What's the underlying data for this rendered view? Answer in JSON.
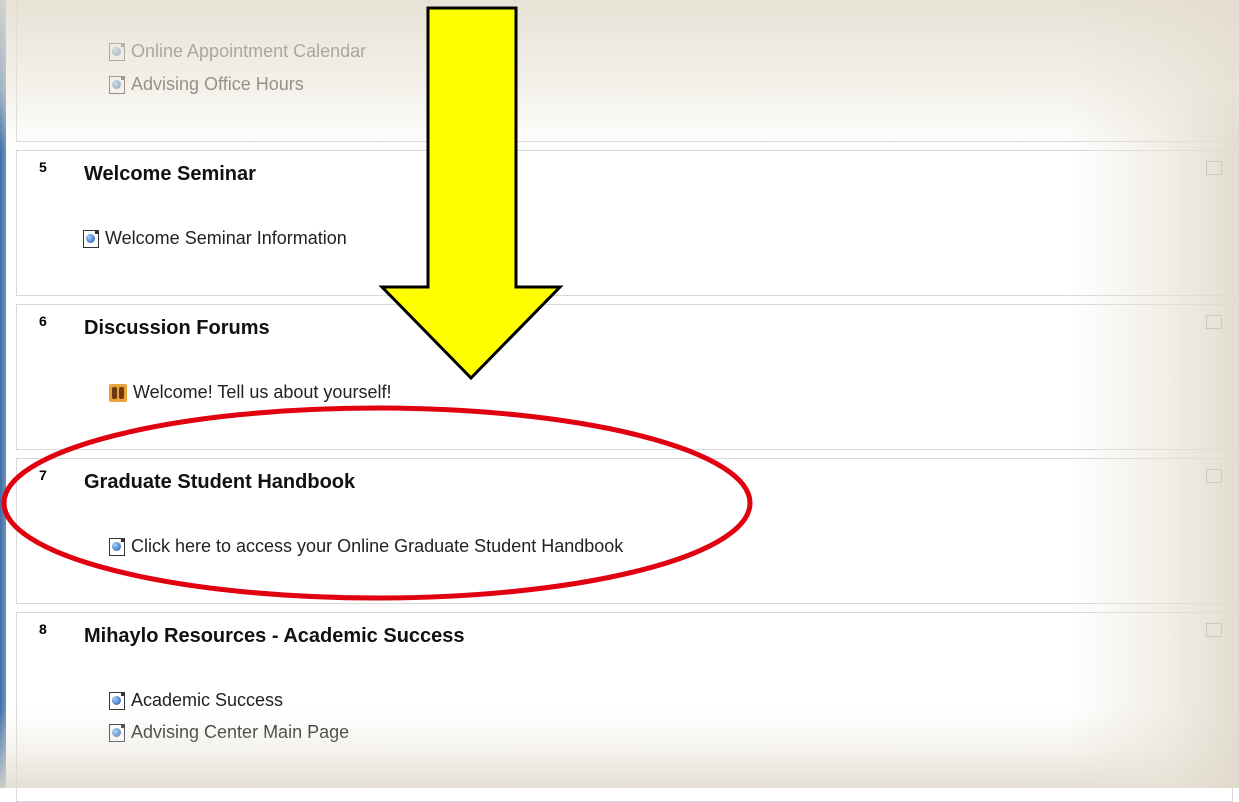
{
  "topics": [
    {
      "number": "",
      "title": "",
      "resources": [
        "Online Appointment Calendar",
        "Advising Office Hours"
      ]
    },
    {
      "number": "5",
      "title": "Welcome Seminar",
      "resources": [
        "Welcome Seminar Information"
      ]
    },
    {
      "number": "6",
      "title": "Discussion Forums",
      "resources": [
        "Welcome! Tell us about yourself!"
      ]
    },
    {
      "number": "7",
      "title": "Graduate Student Handbook",
      "resources": [
        "Click here to access your Online Graduate Student Handbook"
      ]
    },
    {
      "number": "8",
      "title": "Mihaylo Resources - Academic Success",
      "resources": [
        "Academic Success",
        "Advising Center Main Page"
      ]
    }
  ],
  "annotations": {
    "arrow_color": "#ffff00",
    "circle_color": "#e0000f"
  }
}
